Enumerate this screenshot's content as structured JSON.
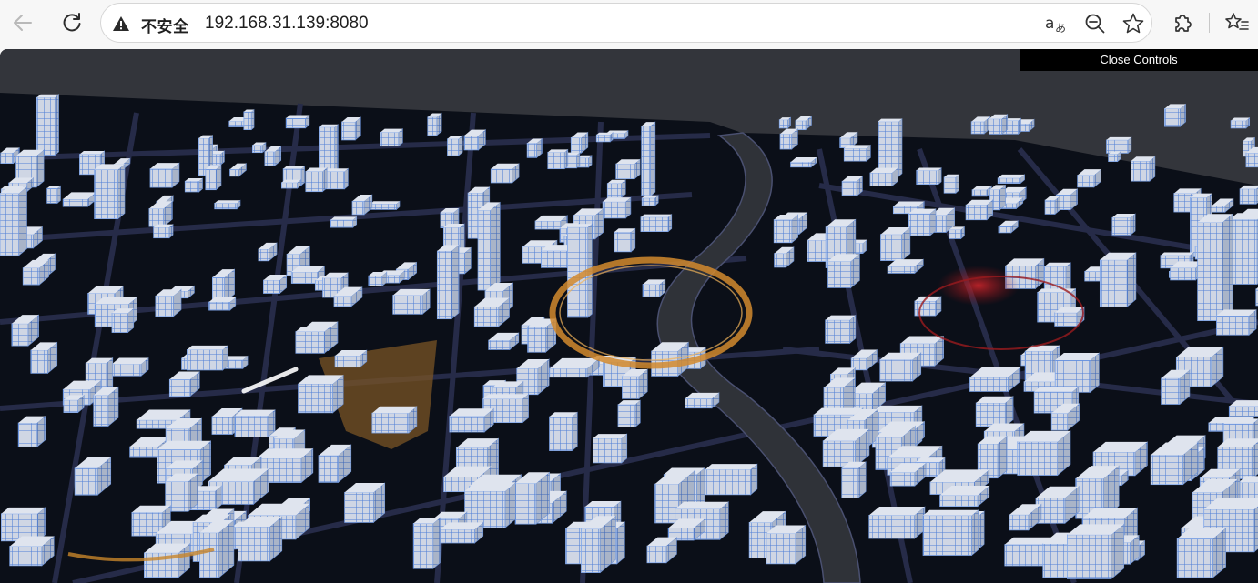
{
  "browser": {
    "security_label": "不安全",
    "url": "192.168.31.139:8080",
    "icons": {
      "back": "back-arrow-icon",
      "reload": "reload-icon",
      "warning": "warning-icon",
      "translate": "translate-icon",
      "zoom": "zoom-out-icon",
      "favorite": "star-icon",
      "extensions": "extensions-icon",
      "favorites": "favorites-list-icon"
    }
  },
  "scene": {
    "controls_label": "Close Controls",
    "colors": {
      "background": "#33353b",
      "ground": "#0b0f18",
      "building_fill": "#c9d1e0",
      "building_grid": "#5b8fe0",
      "river": "#2f3238",
      "road": "#252a45",
      "highlight_orange": "#d28a2e",
      "highlight_red": "#a8181c"
    }
  }
}
